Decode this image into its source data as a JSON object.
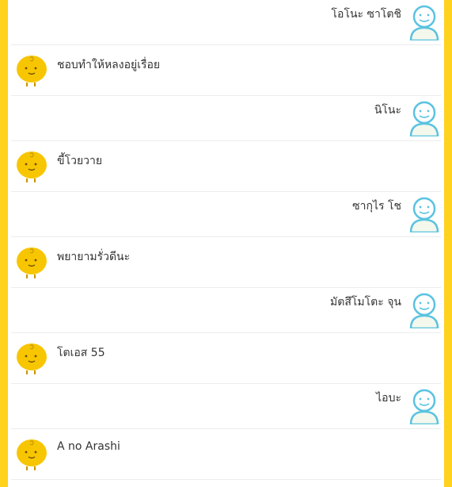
{
  "colors": {
    "frame": "#FFD21E",
    "bot_face": "#F7C600",
    "user_outline": "#5BC3E0"
  },
  "messages": [
    {
      "sender": "user",
      "text": "โอโนะ ซาโตชิ",
      "avatar": "user-avatar-icon"
    },
    {
      "sender": "bot",
      "text": "ชอบทำให้หลงอยู่เรื่อย",
      "avatar": "simsimi-avatar-icon"
    },
    {
      "sender": "user",
      "text": "นิโนะ",
      "avatar": "user-avatar-icon"
    },
    {
      "sender": "bot",
      "text": "ขี้โวยวาย",
      "avatar": "simsimi-avatar-icon"
    },
    {
      "sender": "user",
      "text": "ซากุไร โช",
      "avatar": "user-avatar-icon"
    },
    {
      "sender": "bot",
      "text": "พยายามรั่วดีนะ",
      "avatar": "simsimi-avatar-icon"
    },
    {
      "sender": "user",
      "text": "มัตสึโมโตะ จุน",
      "avatar": "user-avatar-icon"
    },
    {
      "sender": "bot",
      "text": "โตเอส 55",
      "avatar": "simsimi-avatar-icon"
    },
    {
      "sender": "user",
      "text": "ไอบะ",
      "avatar": "user-avatar-icon"
    },
    {
      "sender": "bot",
      "text": "A no Arashi",
      "avatar": "simsimi-avatar-icon"
    }
  ]
}
